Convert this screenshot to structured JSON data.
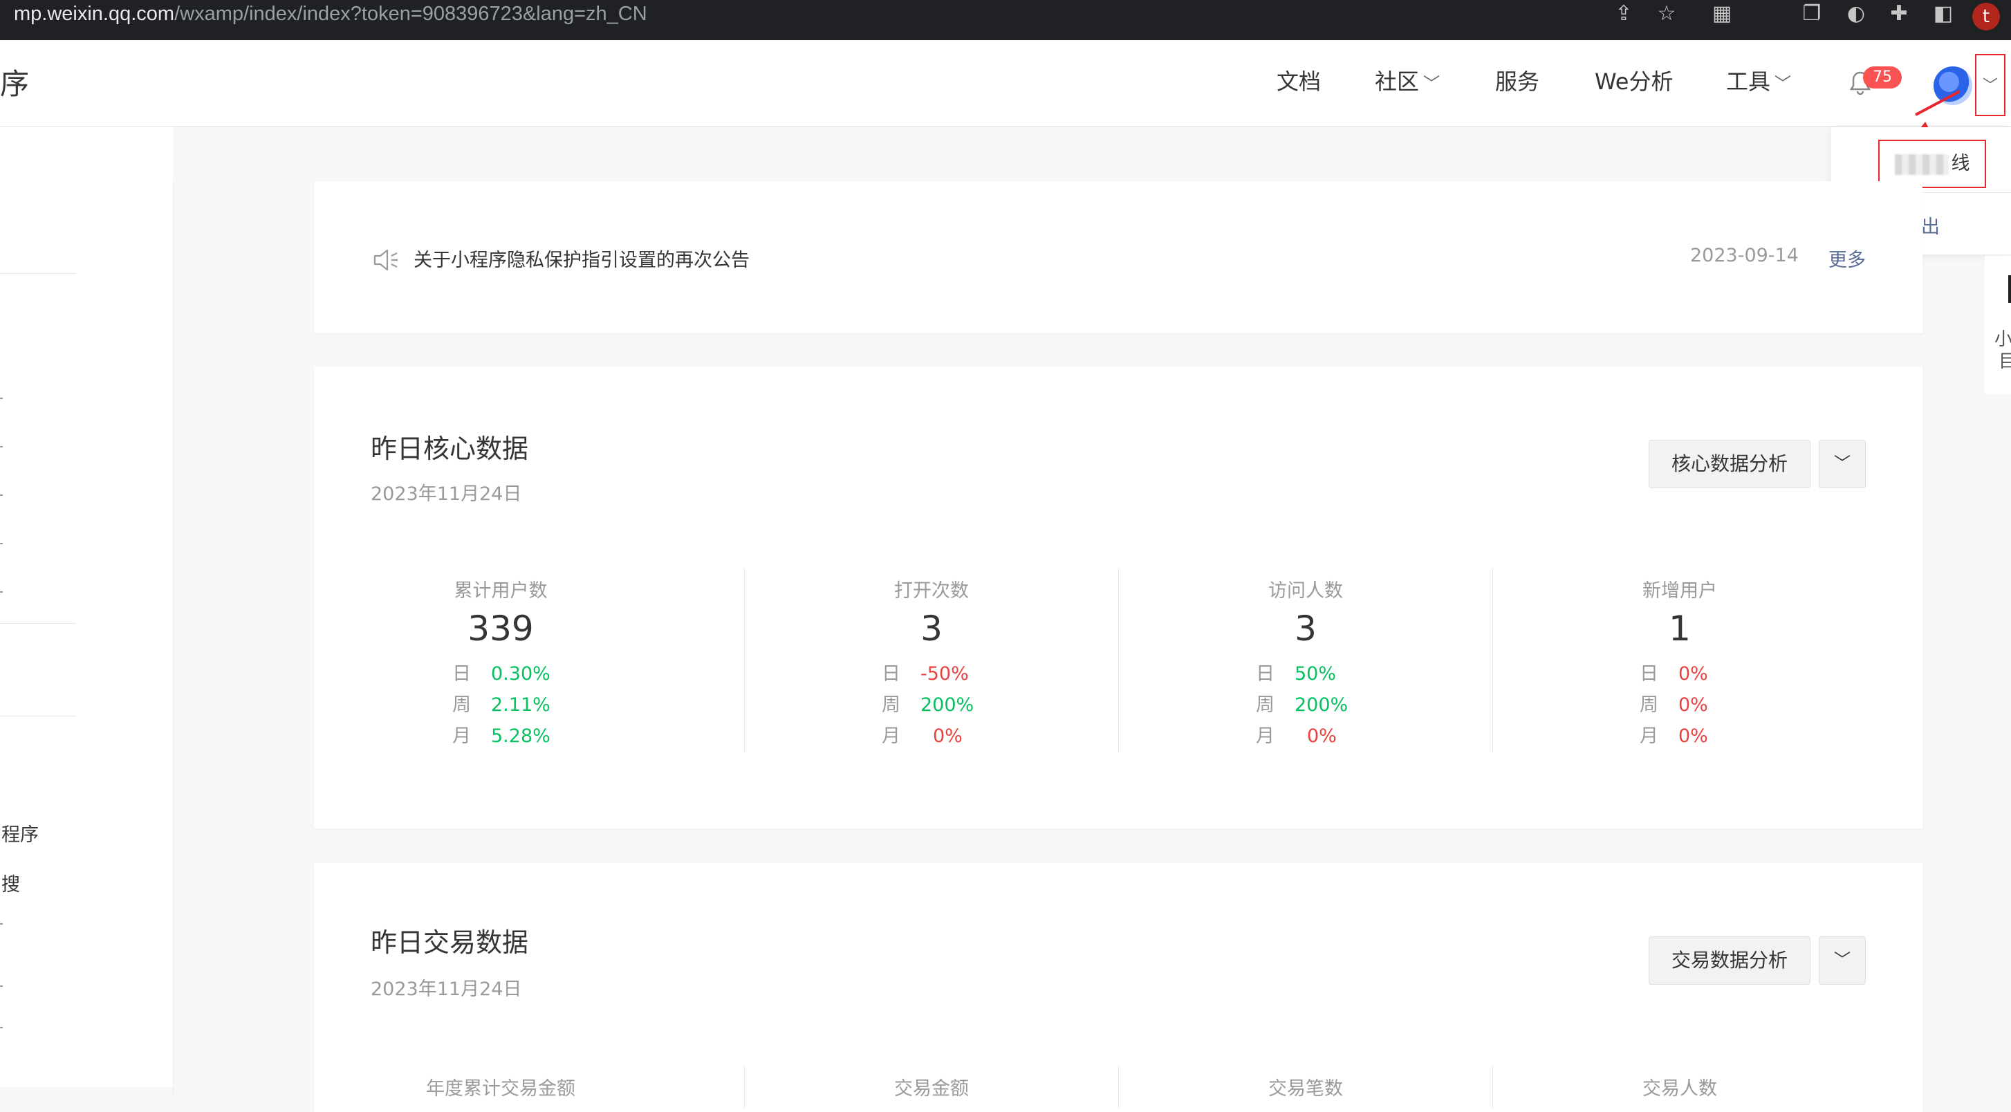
{
  "browser": {
    "url_host": "mp.weixin.qq.com",
    "url_path": "/wxamp/index/index?token=908396723&lang=zh_CN",
    "profile_initial": "t"
  },
  "nav": {
    "brand_fragment": "序",
    "links": [
      "文档",
      "社区",
      "服务",
      "We分析",
      "工具"
    ],
    "notification_count": "75"
  },
  "account_menu": {
    "name_suffix": "线",
    "logout": "退出"
  },
  "sidebar": {
    "items": [
      "程序",
      "搜"
    ]
  },
  "right_panel": {
    "line1": "小",
    "line2": "目"
  },
  "notice": {
    "text": "关于小程序隐私保护指引设置的再次公告",
    "date": "2023-09-14",
    "more": "更多"
  },
  "core": {
    "title": "昨日核心数据",
    "date": "2023年11月24日",
    "button": "核心数据分析",
    "metrics": [
      {
        "label": "累计用户数",
        "value": "339",
        "rows": [
          {
            "k": "日",
            "v": "0.30%",
            "t": "up"
          },
          {
            "k": "周",
            "v": "2.11%",
            "t": "up"
          },
          {
            "k": "月",
            "v": "5.28%",
            "t": "up"
          }
        ]
      },
      {
        "label": "打开次数",
        "value": "3",
        "rows": [
          {
            "k": "日",
            "v": "-50%",
            "t": "down"
          },
          {
            "k": "周",
            "v": "200%",
            "t": "up"
          },
          {
            "k": "月",
            "v": "0%",
            "t": "down"
          }
        ]
      },
      {
        "label": "访问人数",
        "value": "3",
        "rows": [
          {
            "k": "日",
            "v": "50%",
            "t": "up"
          },
          {
            "k": "周",
            "v": "200%",
            "t": "up"
          },
          {
            "k": "月",
            "v": "0%",
            "t": "down"
          }
        ]
      },
      {
        "label": "新增用户",
        "value": "1",
        "rows": [
          {
            "k": "日",
            "v": "0%",
            "t": "down"
          },
          {
            "k": "周",
            "v": "0%",
            "t": "down"
          },
          {
            "k": "月",
            "v": "0%",
            "t": "down"
          }
        ]
      }
    ]
  },
  "trade": {
    "title": "昨日交易数据",
    "date": "2023年11月24日",
    "button": "交易数据分析",
    "metric_labels": [
      "年度累计交易金额",
      "交易金额",
      "交易笔数",
      "交易人数"
    ]
  },
  "colors": {
    "up": "#07c160",
    "down": "#e64340",
    "link": "#576b95",
    "highlight": "#e8262d"
  }
}
